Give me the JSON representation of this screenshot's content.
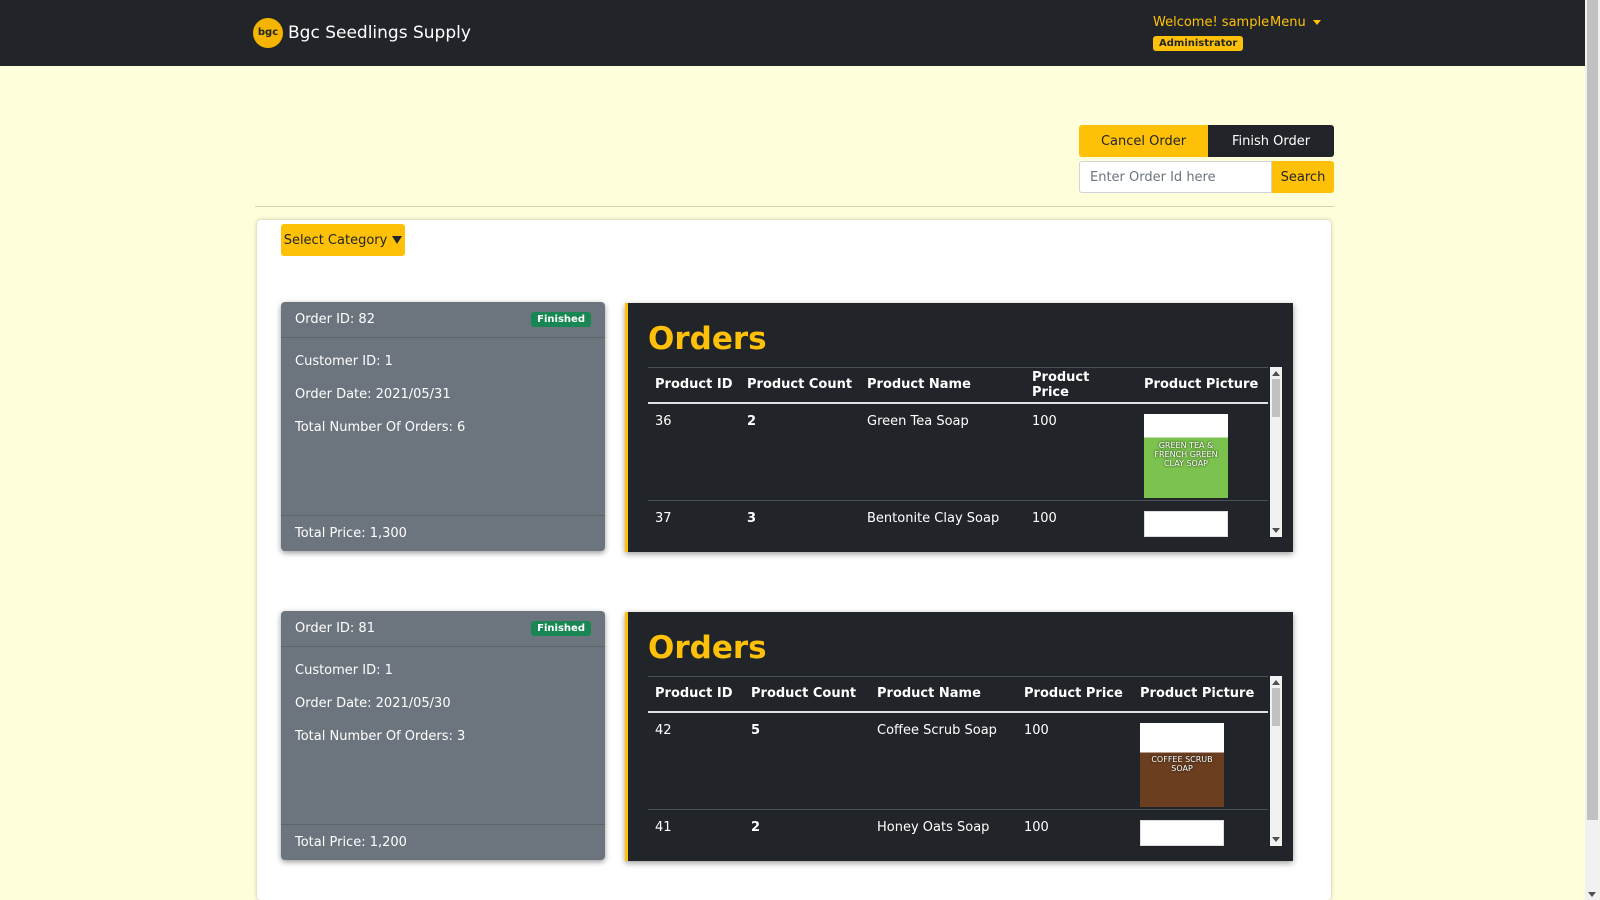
{
  "navbar": {
    "brand": "Bgc Seedlings Supply",
    "logo_text": "bgc",
    "welcome": "Welcome! sample",
    "menu_label": "Menu",
    "role_badge": "Administrator"
  },
  "actions": {
    "cancel_label": "Cancel Order",
    "finish_label": "Finish Order",
    "search_placeholder": "Enter Order Id here",
    "search_value": "",
    "search_label": "Search",
    "category_label": "Select Category"
  },
  "colors": {
    "accent": "#ffc107",
    "dark": "#212529",
    "card": "#6c757d",
    "badge": "#198754",
    "page_bg": "#fffedb"
  },
  "orders": [
    {
      "order_id": "Order ID: 82",
      "status": "Finished",
      "customer_id": "Customer ID: 1",
      "order_date": "Order Date: 2021/05/31",
      "total_orders": "Total Number Of Orders: 6",
      "total_price": "Total Price: 1,300",
      "panel_title": "Orders",
      "columns": [
        "Product ID",
        "Product Count",
        "Product Name",
        "Product Price",
        "Product Picture"
      ],
      "rows": [
        {
          "id": "36",
          "count": "2",
          "name": "Green Tea Soap",
          "price": "100",
          "picture_text": "GREEN TEA & FRENCH GREEN CLAY SOAP"
        },
        {
          "id": "37",
          "count": "3",
          "name": "Bentonite Clay Soap",
          "price": "100",
          "picture_text": ""
        }
      ]
    },
    {
      "order_id": "Order ID: 81",
      "status": "Finished",
      "customer_id": "Customer ID: 1",
      "order_date": "Order Date: 2021/05/30",
      "total_orders": "Total Number Of Orders: 3",
      "total_price": "Total Price: 1,200",
      "panel_title": "Orders",
      "columns": [
        "Product ID",
        "Product Count",
        "Product Name",
        "Product Price",
        "Product Picture"
      ],
      "rows": [
        {
          "id": "42",
          "count": "5",
          "name": "Coffee Scrub Soap",
          "price": "100",
          "picture_text": "COFFEE SCRUB SOAP"
        },
        {
          "id": "41",
          "count": "2",
          "name": "Honey Oats Soap",
          "price": "100",
          "picture_text": ""
        }
      ]
    }
  ]
}
